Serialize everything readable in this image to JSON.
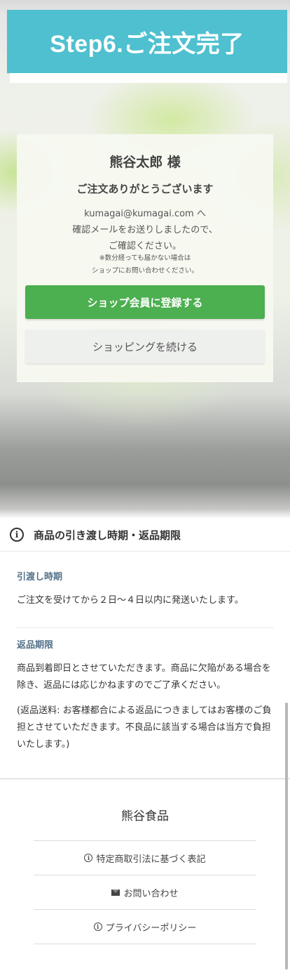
{
  "banner": {
    "title": "Step6.ご注文完了"
  },
  "card": {
    "customer_name": "熊谷太郎 様",
    "thanks": "ご注文ありがとうございます",
    "message_line1": "kumagai@kumagai.com へ",
    "message_line2": "確認メールをお送りしましたので、",
    "message_line3": "ご確認ください。",
    "note_line1": "※数分経っても届かない場合は",
    "note_line2": "ショップにお問い合わせください。",
    "register_button": "ショップ会員に登録する",
    "continue_button": "ショッピングを続ける"
  },
  "delivery_section": {
    "icon": "info-circle-icon",
    "title": "商品の引き渡し時期・返品期限",
    "delivery_heading": "引渡し時期",
    "delivery_text": "ご注文を受けてから２日〜４日以内に発送いたします。",
    "returns_heading": "返品期限",
    "returns_text": "商品到着即日とさせていただきます。商品に欠陥がある場合を除き、返品には応じかねますのでご了承ください。",
    "returns_note": "(返品送料: お客様都合による返品につきましてはお客様のご負担とさせていただきます。不良品に該当する場合は当方で負担いたします。)"
  },
  "footer": {
    "shop_name": "熊谷食品",
    "links": [
      {
        "icon": "info-icon",
        "label": "特定商取引法に基づく表記"
      },
      {
        "icon": "mail-icon",
        "label": "お問い合わせ"
      },
      {
        "icon": "info-icon",
        "label": "プライバシーポリシー"
      }
    ]
  },
  "colors": {
    "banner": "#4ec0cf",
    "register_button": "#4caf50",
    "sub_heading": "#54728a"
  }
}
